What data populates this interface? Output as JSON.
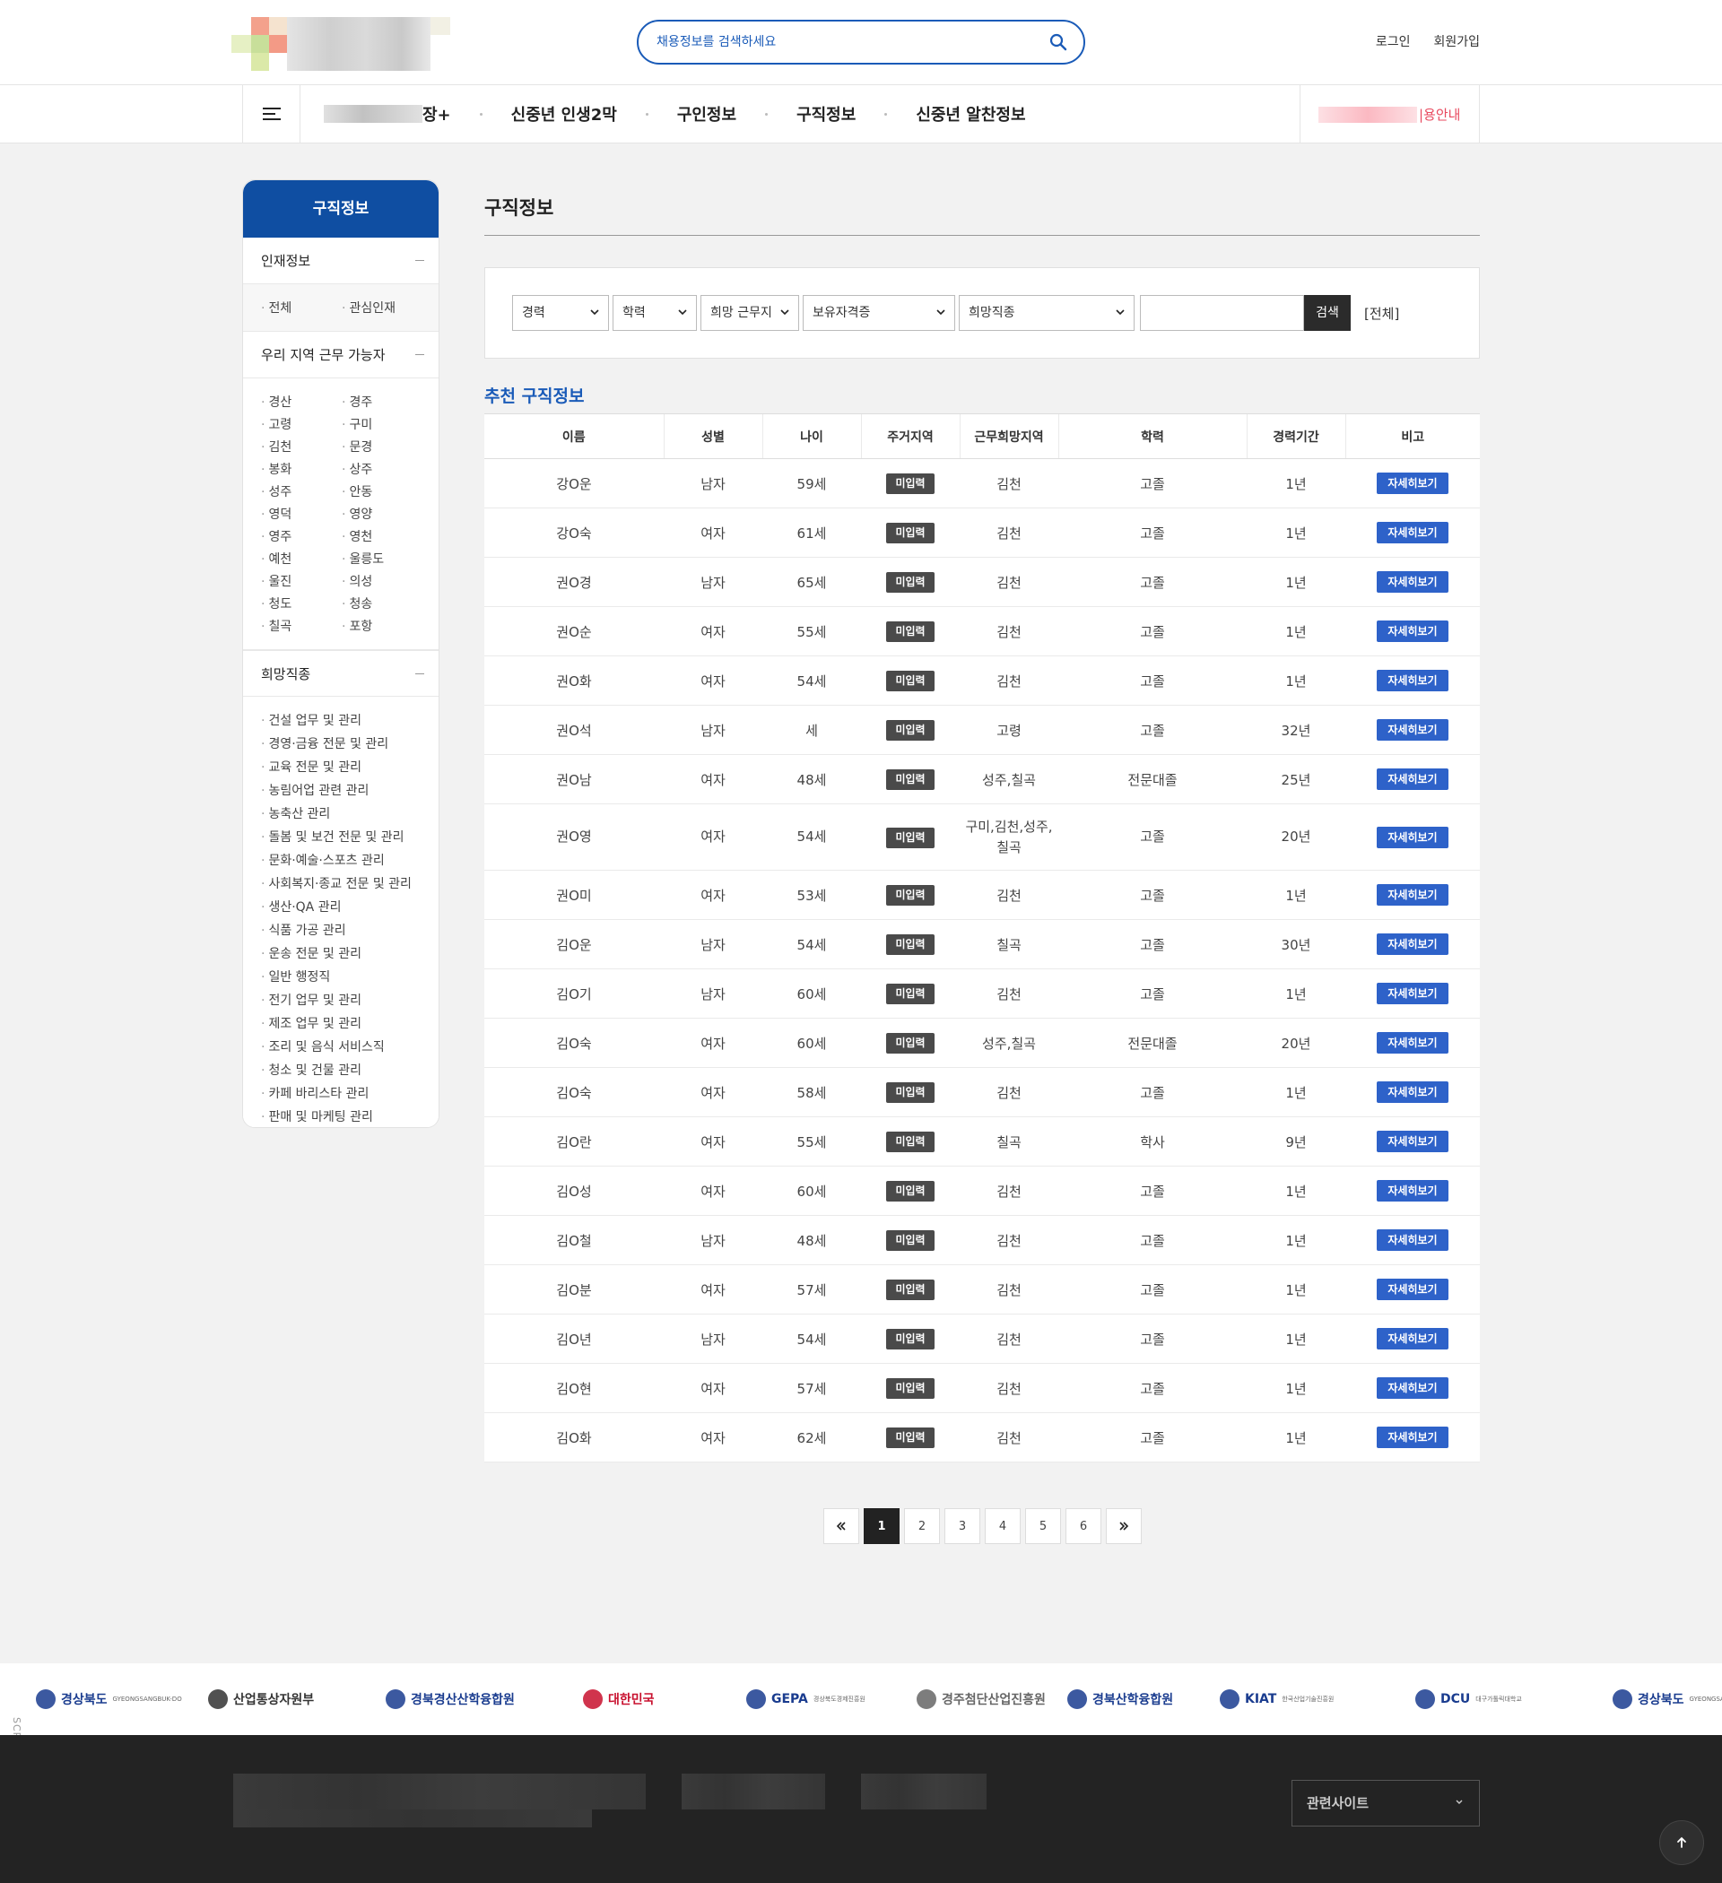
{
  "header": {
    "search_placeholder": "채용정보를 검색하세요",
    "login": "로그인",
    "signup": "회원가입"
  },
  "gnb": {
    "partial_item": "장+",
    "items": [
      "신중년 인생2막",
      "구인정보",
      "구직정보",
      "신중년 알찬정보"
    ],
    "right_link": "|용안내"
  },
  "sidebar": {
    "title": "구직정보",
    "sec1": {
      "title": "인재정보",
      "items": [
        "전체",
        "관심인재"
      ]
    },
    "sec2": {
      "title": "우리 지역 근무 가능자",
      "items": [
        "경산",
        "경주",
        "고령",
        "구미",
        "김천",
        "문경",
        "봉화",
        "상주",
        "성주",
        "안동",
        "영덕",
        "영양",
        "영주",
        "영천",
        "예천",
        "울릉도",
        "울진",
        "의성",
        "청도",
        "청송",
        "칠곡",
        "포항"
      ]
    },
    "sec3": {
      "title": "희망직종",
      "items": [
        "건설 업무 및 관리",
        "경영·금융 전문 및 관리",
        "교육 전문 및 관리",
        "농림어업 관련 관리",
        "농축산 관리",
        "돌봄 및 보건 전문 및 관리",
        "문화·예술·스포츠 관리",
        "사회복지·종교 전문 및 관리",
        "생산·QA 관리",
        "식품 가공 관리",
        "운송 전문 및 관리",
        "일반 행정직",
        "전기 업무 및 관리",
        "제조 업무 및 관리",
        "조리 및 음식 서비스직",
        "청소 및 건물 관리",
        "카페 바리스타 관리",
        "판매 및 마케팅 관리"
      ]
    }
  },
  "content": {
    "page_title": "구직정보",
    "filters": [
      "경력",
      "학력",
      "희망 근무지",
      "보유자격증",
      "희망직종"
    ],
    "search_button": "검색",
    "all_label": "[전체]",
    "section_title": "추천 구직정보",
    "columns": [
      "이름",
      "성별",
      "나이",
      "주거지역",
      "근무희망지역",
      "학력",
      "경력기간",
      "비고"
    ],
    "badge_label": "미입력",
    "detail_label": "자세히보기",
    "rows": [
      [
        "강O운",
        "남자",
        "59세",
        "김천",
        "고졸",
        "1년"
      ],
      [
        "강O숙",
        "여자",
        "61세",
        "김천",
        "고졸",
        "1년"
      ],
      [
        "권O경",
        "남자",
        "65세",
        "김천",
        "고졸",
        "1년"
      ],
      [
        "권O순",
        "여자",
        "55세",
        "김천",
        "고졸",
        "1년"
      ],
      [
        "권O화",
        "여자",
        "54세",
        "김천",
        "고졸",
        "1년"
      ],
      [
        "권O석",
        "남자",
        "세",
        "고령",
        "고졸",
        "32년"
      ],
      [
        "권O남",
        "여자",
        "48세",
        "성주,칠곡",
        "전문대졸",
        "25년"
      ],
      [
        "권O영",
        "여자",
        "54세",
        "구미,김천,성주,\n칠곡",
        "고졸",
        "20년"
      ],
      [
        "권O미",
        "여자",
        "53세",
        "김천",
        "고졸",
        "1년"
      ],
      [
        "김O운",
        "남자",
        "54세",
        "칠곡",
        "고졸",
        "30년"
      ],
      [
        "김O기",
        "남자",
        "60세",
        "김천",
        "고졸",
        "1년"
      ],
      [
        "김O숙",
        "여자",
        "60세",
        "성주,칠곡",
        "전문대졸",
        "20년"
      ],
      [
        "김O숙",
        "여자",
        "58세",
        "김천",
        "고졸",
        "1년"
      ],
      [
        "김O란",
        "여자",
        "55세",
        "칠곡",
        "학사",
        "9년"
      ],
      [
        "김O성",
        "여자",
        "60세",
        "김천",
        "고졸",
        "1년"
      ],
      [
        "김O철",
        "남자",
        "48세",
        "김천",
        "고졸",
        "1년"
      ],
      [
        "김O분",
        "여자",
        "57세",
        "김천",
        "고졸",
        "1년"
      ],
      [
        "김O년",
        "남자",
        "54세",
        "김천",
        "고졸",
        "1년"
      ],
      [
        "김O현",
        "여자",
        "57세",
        "김천",
        "고졸",
        "1년"
      ],
      [
        "김O화",
        "여자",
        "62세",
        "김천",
        "고졸",
        "1년"
      ]
    ]
  },
  "pagination": {
    "first": "«",
    "pages": [
      "1",
      "2",
      "3",
      "4",
      "5",
      "6"
    ],
    "current": "1",
    "last": "»"
  },
  "partners": [
    {
      "name": "경상북도",
      "sub": "GYEONGSANGBUK-DO",
      "color": "#1a3c8f"
    },
    {
      "name": "산업통상자원부",
      "sub": "",
      "color": "#333333"
    },
    {
      "name": "경북경산산학융합원",
      "sub": "",
      "color": "#1a3c8f"
    },
    {
      "name": "대한민국",
      "sub": "",
      "color": "#c8102e"
    },
    {
      "name": "GEPA",
      "sub": "경상북도경제진흥원",
      "color": "#1a3c8f"
    },
    {
      "name": "경주첨단산업진흥원",
      "sub": "",
      "color": "#666666"
    },
    {
      "name": "경북산학융합원",
      "sub": "",
      "color": "#1a3c8f"
    },
    {
      "name": "KIAT",
      "sub": "한국산업기술진흥원",
      "color": "#1a3c8f"
    },
    {
      "name": "DCU",
      "sub": "대구가톨릭대학교",
      "color": "#1a3c8f"
    },
    {
      "name": "경상북도",
      "sub": "GYEONGSANGBUK-DO",
      "color": "#1a3c8f"
    }
  ],
  "scroll_down": "SCROLL DOWN",
  "footer": {
    "related_sites": "관련사이트"
  },
  "colors": {
    "primary": "#0f4ea2",
    "accent_blue": "#2e62c9",
    "badge_gray": "#4a4a4a",
    "footer_bg": "#232323"
  }
}
